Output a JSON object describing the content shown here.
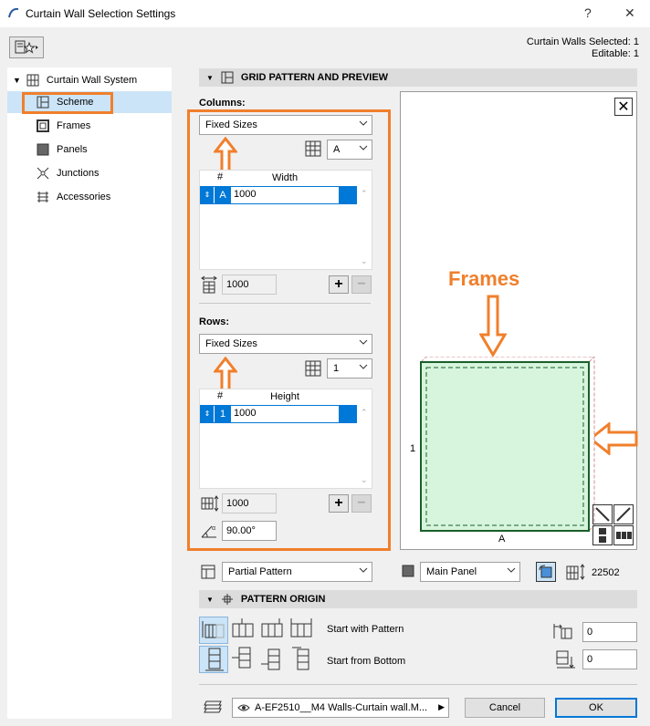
{
  "window": {
    "title": "Curtain Wall Selection Settings",
    "help_glyph": "?",
    "close_glyph": "✕"
  },
  "header": {
    "selected": "Curtain Walls Selected: 1",
    "editable": "Editable: 1"
  },
  "tree": {
    "root": "Curtain Wall System",
    "items": [
      {
        "label": "Scheme",
        "icon": "scheme-icon",
        "selected": true
      },
      {
        "label": "Frames",
        "icon": "frames-icon",
        "selected": false
      },
      {
        "label": "Panels",
        "icon": "panels-icon",
        "selected": false
      },
      {
        "label": "Junctions",
        "icon": "junctions-icon",
        "selected": false
      },
      {
        "label": "Accessories",
        "icon": "accessories-icon",
        "selected": false
      }
    ]
  },
  "grid_section": {
    "title": "GRID PATTERN AND PREVIEW"
  },
  "columns": {
    "label": "Columns:",
    "mode": "Fixed Sizes",
    "pattern_select": "A",
    "table_header_num": "#",
    "table_header_col": "Width",
    "rows": [
      {
        "id": "A",
        "value": "1000"
      }
    ],
    "total": "1000"
  },
  "rows": {
    "label": "Rows:",
    "mode": "Fixed Sizes",
    "pattern_select": "1",
    "table_header_num": "#",
    "table_header_col": "Height",
    "rows": [
      {
        "id": "1",
        "value": "1000"
      }
    ],
    "total": "1000",
    "angle": "90.00°"
  },
  "preview": {
    "annotation": "Frames",
    "row_label": "1",
    "col_label": "A",
    "panel_color": "#d6f5dc"
  },
  "bottom_controls": {
    "pattern_mode": "Partial Pattern",
    "panel_type": "Main Panel",
    "count": "22502"
  },
  "origin_section": {
    "title": "PATTERN ORIGIN",
    "start_pattern_label": "Start with Pattern",
    "start_bottom_label": "Start from Bottom",
    "x_offset": "0",
    "y_offset": "0"
  },
  "footer": {
    "layer": "A-EF2510__M4 Walls-Curtain wall.M...",
    "cancel": "Cancel",
    "ok": "OK"
  },
  "colors": {
    "accent_orange": "#f07f2b",
    "selection_blue": "#0078d7",
    "tree_selection": "#cce4f7"
  }
}
